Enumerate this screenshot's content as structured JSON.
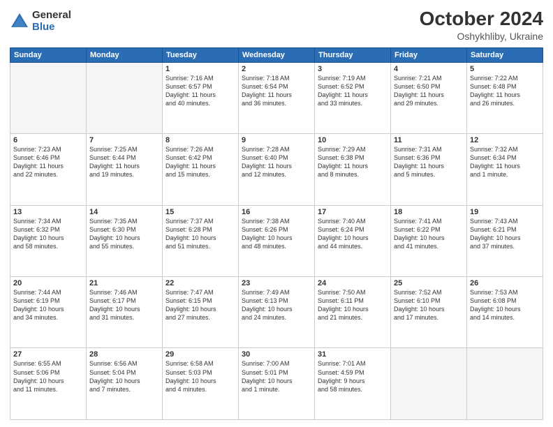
{
  "logo": {
    "general": "General",
    "blue": "Blue"
  },
  "title": "October 2024",
  "subtitle": "Oshykhliby, Ukraine",
  "days_header": [
    "Sunday",
    "Monday",
    "Tuesday",
    "Wednesday",
    "Thursday",
    "Friday",
    "Saturday"
  ],
  "weeks": [
    [
      {
        "num": "",
        "info": ""
      },
      {
        "num": "",
        "info": ""
      },
      {
        "num": "1",
        "info": "Sunrise: 7:16 AM\nSunset: 6:57 PM\nDaylight: 11 hours\nand 40 minutes."
      },
      {
        "num": "2",
        "info": "Sunrise: 7:18 AM\nSunset: 6:54 PM\nDaylight: 11 hours\nand 36 minutes."
      },
      {
        "num": "3",
        "info": "Sunrise: 7:19 AM\nSunset: 6:52 PM\nDaylight: 11 hours\nand 33 minutes."
      },
      {
        "num": "4",
        "info": "Sunrise: 7:21 AM\nSunset: 6:50 PM\nDaylight: 11 hours\nand 29 minutes."
      },
      {
        "num": "5",
        "info": "Sunrise: 7:22 AM\nSunset: 6:48 PM\nDaylight: 11 hours\nand 26 minutes."
      }
    ],
    [
      {
        "num": "6",
        "info": "Sunrise: 7:23 AM\nSunset: 6:46 PM\nDaylight: 11 hours\nand 22 minutes."
      },
      {
        "num": "7",
        "info": "Sunrise: 7:25 AM\nSunset: 6:44 PM\nDaylight: 11 hours\nand 19 minutes."
      },
      {
        "num": "8",
        "info": "Sunrise: 7:26 AM\nSunset: 6:42 PM\nDaylight: 11 hours\nand 15 minutes."
      },
      {
        "num": "9",
        "info": "Sunrise: 7:28 AM\nSunset: 6:40 PM\nDaylight: 11 hours\nand 12 minutes."
      },
      {
        "num": "10",
        "info": "Sunrise: 7:29 AM\nSunset: 6:38 PM\nDaylight: 11 hours\nand 8 minutes."
      },
      {
        "num": "11",
        "info": "Sunrise: 7:31 AM\nSunset: 6:36 PM\nDaylight: 11 hours\nand 5 minutes."
      },
      {
        "num": "12",
        "info": "Sunrise: 7:32 AM\nSunset: 6:34 PM\nDaylight: 11 hours\nand 1 minute."
      }
    ],
    [
      {
        "num": "13",
        "info": "Sunrise: 7:34 AM\nSunset: 6:32 PM\nDaylight: 10 hours\nand 58 minutes."
      },
      {
        "num": "14",
        "info": "Sunrise: 7:35 AM\nSunset: 6:30 PM\nDaylight: 10 hours\nand 55 minutes."
      },
      {
        "num": "15",
        "info": "Sunrise: 7:37 AM\nSunset: 6:28 PM\nDaylight: 10 hours\nand 51 minutes."
      },
      {
        "num": "16",
        "info": "Sunrise: 7:38 AM\nSunset: 6:26 PM\nDaylight: 10 hours\nand 48 minutes."
      },
      {
        "num": "17",
        "info": "Sunrise: 7:40 AM\nSunset: 6:24 PM\nDaylight: 10 hours\nand 44 minutes."
      },
      {
        "num": "18",
        "info": "Sunrise: 7:41 AM\nSunset: 6:22 PM\nDaylight: 10 hours\nand 41 minutes."
      },
      {
        "num": "19",
        "info": "Sunrise: 7:43 AM\nSunset: 6:21 PM\nDaylight: 10 hours\nand 37 minutes."
      }
    ],
    [
      {
        "num": "20",
        "info": "Sunrise: 7:44 AM\nSunset: 6:19 PM\nDaylight: 10 hours\nand 34 minutes."
      },
      {
        "num": "21",
        "info": "Sunrise: 7:46 AM\nSunset: 6:17 PM\nDaylight: 10 hours\nand 31 minutes."
      },
      {
        "num": "22",
        "info": "Sunrise: 7:47 AM\nSunset: 6:15 PM\nDaylight: 10 hours\nand 27 minutes."
      },
      {
        "num": "23",
        "info": "Sunrise: 7:49 AM\nSunset: 6:13 PM\nDaylight: 10 hours\nand 24 minutes."
      },
      {
        "num": "24",
        "info": "Sunrise: 7:50 AM\nSunset: 6:11 PM\nDaylight: 10 hours\nand 21 minutes."
      },
      {
        "num": "25",
        "info": "Sunrise: 7:52 AM\nSunset: 6:10 PM\nDaylight: 10 hours\nand 17 minutes."
      },
      {
        "num": "26",
        "info": "Sunrise: 7:53 AM\nSunset: 6:08 PM\nDaylight: 10 hours\nand 14 minutes."
      }
    ],
    [
      {
        "num": "27",
        "info": "Sunrise: 6:55 AM\nSunset: 5:06 PM\nDaylight: 10 hours\nand 11 minutes."
      },
      {
        "num": "28",
        "info": "Sunrise: 6:56 AM\nSunset: 5:04 PM\nDaylight: 10 hours\nand 7 minutes."
      },
      {
        "num": "29",
        "info": "Sunrise: 6:58 AM\nSunset: 5:03 PM\nDaylight: 10 hours\nand 4 minutes."
      },
      {
        "num": "30",
        "info": "Sunrise: 7:00 AM\nSunset: 5:01 PM\nDaylight: 10 hours\nand 1 minute."
      },
      {
        "num": "31",
        "info": "Sunrise: 7:01 AM\nSunset: 4:59 PM\nDaylight: 9 hours\nand 58 minutes."
      },
      {
        "num": "",
        "info": ""
      },
      {
        "num": "",
        "info": ""
      }
    ]
  ]
}
